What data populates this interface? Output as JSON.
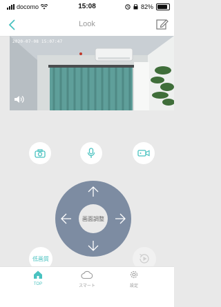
{
  "status_bar": {
    "carrier": "docomo",
    "time": "15:08",
    "battery": "82%"
  },
  "nav": {
    "title": "Look"
  },
  "video": {
    "timestamp": "2020-07-08 15:07:47"
  },
  "controls": {
    "camera_icon": "camera-icon",
    "mic_icon": "microphone-icon",
    "record_icon": "video-record-icon",
    "center_label": "画面調整",
    "low_quality_label": "低画質"
  },
  "tabs": [
    {
      "label": "TOP",
      "icon": "home-icon"
    },
    {
      "label": "スマート",
      "icon": "cloud-icon"
    },
    {
      "label": "設定",
      "icon": "gear-icon"
    }
  ],
  "colors": {
    "accent": "#49c2c0",
    "dpad": "#7d8ca2",
    "background": "#e9e9e9"
  }
}
